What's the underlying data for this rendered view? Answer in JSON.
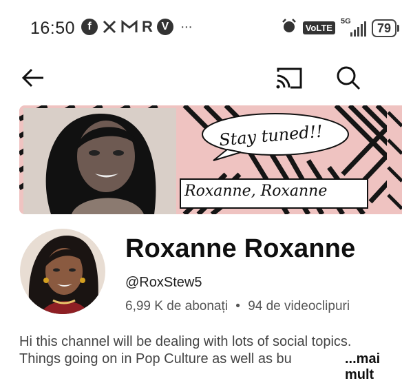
{
  "status_bar": {
    "time": "16:50",
    "app_icons": [
      "facebook-icon",
      "x-icon",
      "gmail-icon",
      "r-app-icon",
      "v-app-icon"
    ],
    "overflow": "···",
    "network_badge": "VoLTE",
    "network_type": "5G",
    "battery": "79"
  },
  "toolbar": {
    "back": "back-arrow-icon",
    "cast": "cast-icon",
    "search": "search-icon"
  },
  "banner": {
    "speech_text": "Stay tuned!!",
    "caption": "Roxanne, Roxanne",
    "accent_color": "#efc3c1"
  },
  "channel": {
    "name": "Roxanne Roxanne",
    "handle": "@RoxStew5",
    "subscribers": "6,99 K de abonați",
    "separator": "•",
    "videos": "94 de videoclipuri",
    "description_line1": "Hi this channel will be dealing with lots of social topics.",
    "description_line2": "Things going on in Pop Culture as well as bu",
    "more_label": "...mai mult"
  }
}
